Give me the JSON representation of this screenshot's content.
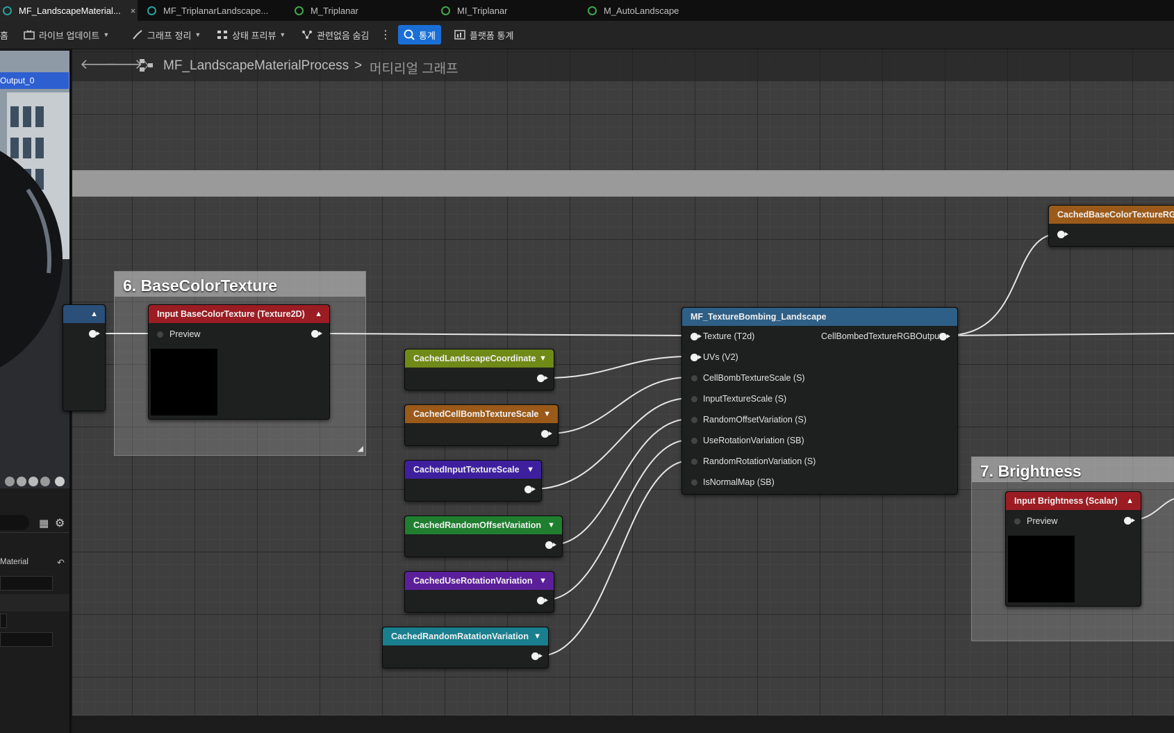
{
  "tabs": [
    {
      "label": "MF_LandscapeMaterial...",
      "active": true,
      "close": "×"
    },
    {
      "label": "MF_TriplanarLandscape..."
    },
    {
      "label": "M_Triplanar"
    },
    {
      "label": "MI_Triplanar"
    },
    {
      "label": "M_AutoLandscape"
    }
  ],
  "toolbar": {
    "home": "홈",
    "live_update": "라이브 업데이트",
    "clean_graph": "그래프 정리",
    "state_preview": "상태 프리뷰",
    "hide_unrelated": "관련없음 숨김",
    "stats": "통계",
    "platform_stats": "플랫폼 통계"
  },
  "breadcrumb": {
    "asset": "MF_LandscapeMaterialProcess",
    "separator": ">",
    "graph": "머티리얼 그래프"
  },
  "viewport": {
    "output_label": "Output_0"
  },
  "details": {
    "material_label": "Material"
  },
  "comments": {
    "basecolor": "6. BaseColorTexture",
    "brightness": "7. Brightness"
  },
  "nodes": {
    "input_basecolor": {
      "title": "Input BaseColorTexture (Texture2D)",
      "pin": "Preview",
      "color": "#9b1c22"
    },
    "input_brightness": {
      "title": "Input Brightness (Scalar)",
      "pin": "Preview",
      "color": "#9b1c22"
    },
    "cached_landscape_coord": {
      "title": "CachedLandscapeCoordinate",
      "color": "#6f8a17"
    },
    "cached_cellbomb_scale": {
      "title": "CachedCellBombTextureScale",
      "color": "#9b5a19"
    },
    "cached_input_scale": {
      "title": "CachedInputTextureScale",
      "color": "#3e1f9e"
    },
    "cached_random_offset": {
      "title": "CachedRandomOffsetVariation",
      "color": "#1f7f2f"
    },
    "cached_use_rotation": {
      "title": "CachedUseRotationVariation",
      "color": "#5c1f9a"
    },
    "cached_random_rotation": {
      "title": "CachedRandomRatationVariation",
      "color": "#197f8e"
    },
    "cached_basecolor_rgb": {
      "title": "CachedBaseColorTextureRGB",
      "color": "#9b5a19"
    },
    "texture_bombing": {
      "title": "MF_TextureBombing_Landscape",
      "color": "#2e5f86",
      "inputs": [
        "Texture (T2d)",
        "UVs (V2)",
        "CellBombTextureScale (S)",
        "InputTextureScale (S)",
        "RandomOffsetVariation (S)",
        "UseRotationVariation (SB)",
        "RandomRotationVariation (S)",
        "IsNormalMap (SB)"
      ],
      "output": "CellBombedTextureRGBOutput"
    }
  }
}
